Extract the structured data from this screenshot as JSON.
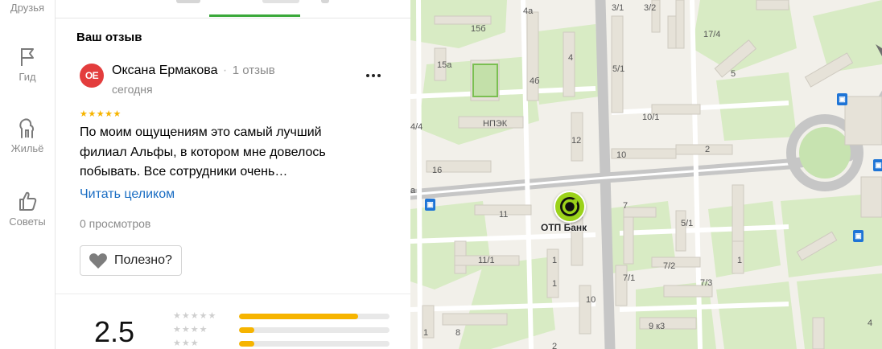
{
  "rail": {
    "items": [
      {
        "label": "Друзья",
        "icon": "friends-icon"
      },
      {
        "label": "Гид",
        "icon": "flag-icon"
      },
      {
        "label": "Жильё",
        "icon": "house-icon"
      },
      {
        "label": "Советы",
        "icon": "thumbs-up-icon"
      }
    ]
  },
  "review": {
    "section_title": "Ваш отзыв",
    "avatar_initials": "ОЕ",
    "author_name": "Оксана Ермакова",
    "separator": "·",
    "review_count": "1 отзыв",
    "date": "сегодня",
    "rating": 5,
    "stars": "★★★★★",
    "text": "По моим ощущениям это самый лучший филиал Альфы, в котором мне довелось побывать. Все сотрудники очень…",
    "read_more": "Читать целиком",
    "views": "0 просмотров",
    "useful_label": "Полезно?",
    "colors": {
      "avatar": "#e33d3d",
      "stars": "#f6b400",
      "link": "#1a6dc3"
    }
  },
  "summary": {
    "average": "2.5",
    "distribution": [
      {
        "stars": "★★★★★",
        "share": 0.79
      },
      {
        "stars": "★★★★",
        "share": 0.1
      },
      {
        "stars": "★★★",
        "share": 0.1
      }
    ]
  },
  "map": {
    "poi": {
      "name": "ОТП Банк",
      "icon": "otp-bank-icon",
      "color": "#9bd21a"
    },
    "house_numbers": [
      "3/1",
      "3/2",
      "4а",
      "15б",
      "17/4",
      "15а",
      "4",
      "4б",
      "5/1",
      "5",
      "4/4",
      "НПЭК",
      "10/1",
      "12",
      "10",
      "2",
      "16",
      "а",
      "11",
      "7",
      "5/1",
      "11/1",
      "1",
      "7/2",
      "7/1",
      "7/3",
      "1",
      "10",
      "8",
      "9 к3",
      "4",
      "1",
      "1",
      "2"
    ]
  }
}
